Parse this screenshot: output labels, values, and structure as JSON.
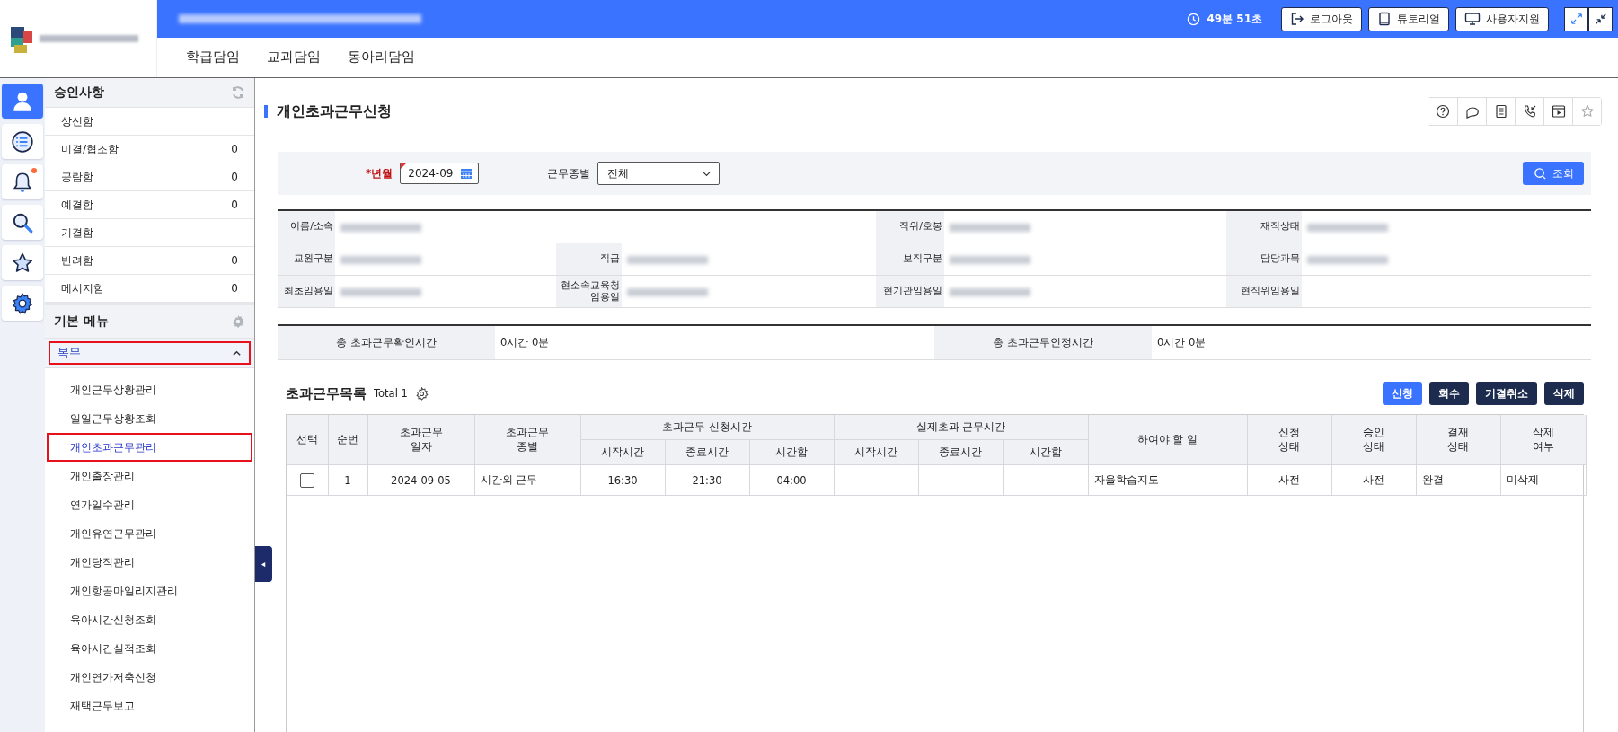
{
  "header": {
    "timer": "49분 51초",
    "buttons": [
      {
        "kind": "logout",
        "label": "로그아웃"
      },
      {
        "kind": "tutorial",
        "label": "튜토리얼"
      },
      {
        "kind": "support",
        "label": "사용자지원"
      }
    ]
  },
  "nav_tabs": [
    {
      "label": "학급담임",
      "selected": false
    },
    {
      "label": "교과담임",
      "selected": false
    },
    {
      "label": "동아리담임",
      "selected": false
    }
  ],
  "rail": [
    {
      "kind": "person",
      "selected": true,
      "badge": false
    },
    {
      "kind": "list",
      "selected": false,
      "badge": false
    },
    {
      "kind": "bell",
      "selected": false,
      "badge": true
    },
    {
      "kind": "search",
      "selected": false,
      "badge": false
    },
    {
      "kind": "star",
      "selected": false,
      "badge": false
    },
    {
      "kind": "gear",
      "selected": false,
      "badge": false
    }
  ],
  "approvals": {
    "title": "승인사항",
    "items": [
      {
        "label": "상신함"
      },
      {
        "label": "미결/협조함",
        "count": "0"
      },
      {
        "label": "공람함",
        "count": "0"
      },
      {
        "label": "예결함",
        "count": "0"
      },
      {
        "label": "기결함"
      },
      {
        "label": "반려함",
        "count": "0"
      },
      {
        "label": "메시지함",
        "count": "0"
      }
    ]
  },
  "menu": {
    "title": "기본 메뉴",
    "group": {
      "label": "복무",
      "expanded": true,
      "highlighted": true
    },
    "items": [
      {
        "label": "개인근무상황관리",
        "selected": false,
        "highlighted": false
      },
      {
        "label": "일일근무상황조회",
        "selected": false,
        "highlighted": false
      },
      {
        "label": "개인초과근무관리",
        "selected": true,
        "highlighted": true
      },
      {
        "label": "개인출장관리",
        "selected": false,
        "highlighted": false
      },
      {
        "label": "연가일수관리",
        "selected": false,
        "highlighted": false
      },
      {
        "label": "개인유연근무관리",
        "selected": false,
        "highlighted": false
      },
      {
        "label": "개인당직관리",
        "selected": false,
        "highlighted": false
      },
      {
        "label": "개인항공마일리지관리",
        "selected": false,
        "highlighted": false
      },
      {
        "label": "육아시간신청조회",
        "selected": false,
        "highlighted": false
      },
      {
        "label": "육아시간실적조회",
        "selected": false,
        "highlighted": false
      },
      {
        "label": "개인연가저축신청",
        "selected": false,
        "highlighted": false
      },
      {
        "label": "재택근무보고",
        "selected": false,
        "highlighted": false
      }
    ]
  },
  "page": {
    "title": "개인초과근무신청",
    "tools": [
      {
        "kind": "help"
      },
      {
        "kind": "chat"
      },
      {
        "kind": "doc"
      },
      {
        "kind": "phone"
      },
      {
        "kind": "video"
      },
      {
        "kind": "star"
      }
    ]
  },
  "search": {
    "year_month_label": "*년월",
    "year_month": "2024-09",
    "type_label": "근무종별",
    "type_value": "전체",
    "button": "조회"
  },
  "info": [
    [
      {
        "label": "이름/소속",
        "redacted": true
      },
      {
        "label": "직위/호봉",
        "redacted": true
      },
      {
        "label": "재직상태",
        "redacted": true
      }
    ],
    [
      {
        "label": "교원구분",
        "redacted": true
      },
      {
        "label": "직급",
        "redacted": true
      },
      {
        "label": "보직구분",
        "redacted": true
      },
      {
        "label": "담당과목",
        "redacted": true
      }
    ],
    [
      {
        "label": "최초임용일",
        "redacted": true
      },
      {
        "label": "현소속교육청\n임용일",
        "redacted": true
      },
      {
        "label": "현기관임용일",
        "redacted": true
      },
      {
        "label": "현직위임용일",
        "redacted": false
      }
    ]
  ],
  "totals": [
    {
      "label": "총 초과근무확인시간",
      "value": "0시간 0분"
    },
    {
      "label": "총 초과근무인정시간",
      "value": "0시간 0분"
    }
  ],
  "list": {
    "title": "초과근무목록",
    "total": "Total 1",
    "buttons": [
      {
        "label": "신청",
        "kind": "primary"
      },
      {
        "label": "회수",
        "kind": "dark"
      },
      {
        "label": "기결취소",
        "kind": "dark"
      },
      {
        "label": "삭제",
        "kind": "dark"
      }
    ],
    "columns": [
      {
        "label": "선택"
      },
      {
        "label": "순번"
      },
      {
        "label": "초과근무\n일자"
      },
      {
        "label": "초과근무\n종별"
      },
      {
        "group": "초과근무 신청시간",
        "colspan": 3,
        "children": [
          "시작시간",
          "종료시간",
          "시간합"
        ]
      },
      {
        "group": "실제초과 근무시간",
        "colspan": 3,
        "children": [
          "시작시간",
          "종료시간",
          "시간합"
        ]
      },
      {
        "label": "하여야 할 일"
      },
      {
        "label": "신청\n상태"
      },
      {
        "label": "승인\n상태"
      },
      {
        "label": "결재\n상태"
      },
      {
        "label": "삭제\n여부"
      }
    ],
    "rows": [
      {
        "checked": false,
        "cells": [
          "",
          "1",
          "2024-09-05",
          "시간외 근무",
          "16:30",
          "21:30",
          "04:00",
          "",
          "",
          "",
          "자율학습지도",
          "사전",
          "사전",
          "완결",
          "미삭제"
        ]
      }
    ]
  }
}
